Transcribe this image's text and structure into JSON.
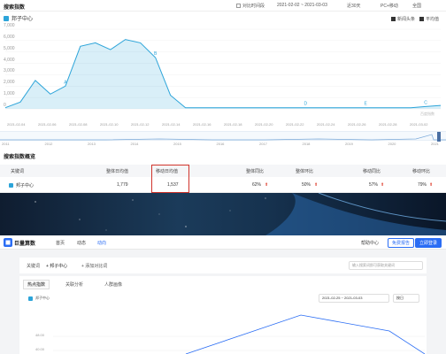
{
  "section1": {
    "title": "搜索指数",
    "compare_label": "对比时间段",
    "date_range": "2021-02-02 ~ 2021-03-03",
    "period": "近30天",
    "device": "PC+移动",
    "region": "全国",
    "legend_label": "邦子中心",
    "news_toggle": "新闻头条",
    "mean_toggle": "平均值",
    "y_ticks": [
      "7,000",
      "6,000",
      "5,000",
      "4,000",
      "3,000",
      "2,000",
      "1,000",
      "0"
    ],
    "x_ticks": [
      "2021-02-04",
      "2021-02-06",
      "2021-02-08",
      "2021-02-10",
      "2021-02-12",
      "2021-02-14",
      "2021-02-16",
      "2021-02-18",
      "2021-02-20",
      "2021-02-22",
      "2021-02-24",
      "2021-02-26",
      "2021-02-28",
      "2021-03-02"
    ],
    "watermark": "百度指数",
    "overview_years": [
      "2011",
      "2012",
      "2013",
      "2014",
      "2015",
      "2016",
      "2017",
      "2018",
      "2019",
      "2020",
      "2021"
    ]
  },
  "chart_data": {
    "type": "area",
    "series": [
      {
        "name": "邦子中心",
        "x": [
          "2021-02-02",
          "2021-02-03",
          "2021-02-04",
          "2021-02-05",
          "2021-02-06",
          "2021-02-07",
          "2021-02-08",
          "2021-02-09",
          "2021-02-10",
          "2021-02-11",
          "2021-02-12",
          "2021-02-13",
          "2021-02-14",
          "2021-02-15",
          "2021-02-16",
          "2021-02-17",
          "2021-02-18",
          "2021-02-19",
          "2021-02-20",
          "2021-02-21",
          "2021-02-22",
          "2021-02-23",
          "2021-02-24",
          "2021-02-25",
          "2021-02-26",
          "2021-02-27",
          "2021-02-28",
          "2021-03-01",
          "2021-03-02",
          "2021-03-03"
        ],
        "values": [
          100,
          600,
          2500,
          1300,
          2000,
          5500,
          5800,
          5200,
          6100,
          5800,
          4500,
          1200,
          100,
          100,
          100,
          100,
          100,
          100,
          100,
          100,
          100,
          100,
          100,
          100,
          100,
          100,
          100,
          100,
          200,
          300
        ]
      }
    ],
    "annotations": [
      "A",
      "B",
      "C",
      "D",
      "E"
    ],
    "ylim": [
      0,
      7000
    ],
    "grid": true,
    "legend_position": "top-left"
  },
  "section2": {
    "title": "搜索指数概览",
    "headers": [
      "关键词",
      "整体日均值",
      "移动日均值",
      "整体同比",
      "整体环比",
      "移动同比",
      "移动环比"
    ],
    "row": [
      "邦子中心",
      "1,779",
      "1,537",
      "62%",
      "50%",
      "57%",
      "79%"
    ]
  },
  "nav": {
    "logo": "巨量算数",
    "items": [
      "首页",
      "动态",
      "动向"
    ],
    "help": "帮助中心",
    "reports": "免费报告",
    "login_button": "立即登录"
  },
  "panel": {
    "keyword_label": "关键词",
    "keyword_value": "+ 邦子中心",
    "add_compare": "+ 添加对比词",
    "search_placeholder": "输入搜索词即可获取关键词",
    "tabs": [
      "热点指数",
      "关联分析",
      "人群画像"
    ],
    "legend_label": "邦子中心",
    "date_range": "2021-02-25 ~ 2021-03-03",
    "granularity": "按日",
    "y_ticks": [
      "48.00",
      "40.00"
    ]
  }
}
